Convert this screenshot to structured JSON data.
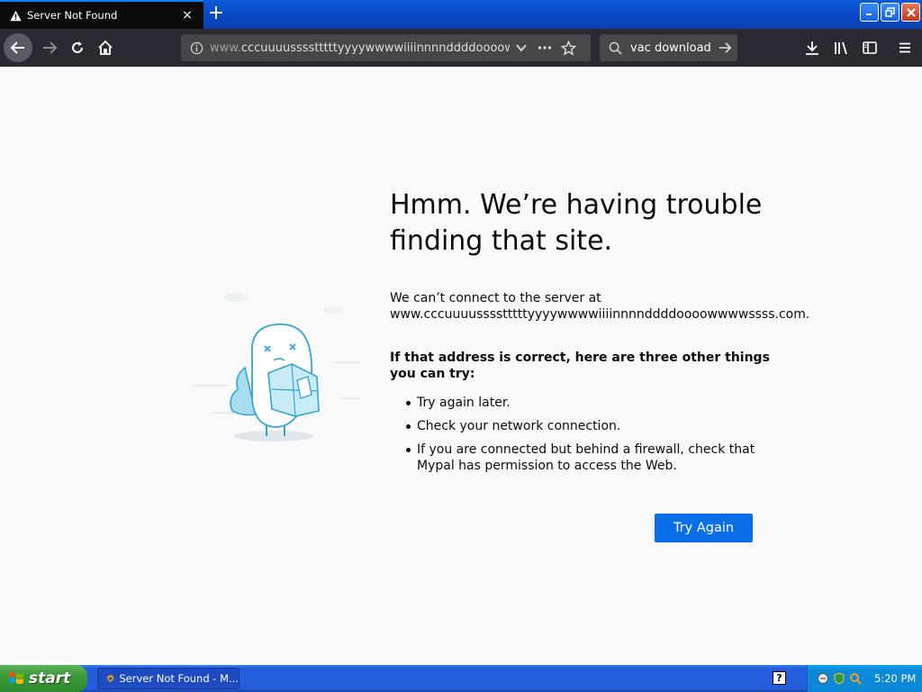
{
  "browser": {
    "tab": {
      "title": "Server Not Found",
      "close_label": "×",
      "icon": "warning-icon"
    },
    "new_tab_label": "+",
    "window_buttons": {
      "minimize": "_",
      "restore": "❐",
      "close": "✕"
    },
    "urlbar": {
      "url_prefix": "www.",
      "url_rest": "cccuuuusssstttttyyyywwwwiiiinnnnddddoooowwwwssss.com",
      "icons": [
        "info-icon",
        "chevron-down-icon",
        "more-icon",
        "star-icon"
      ]
    },
    "search": {
      "value": "vac download",
      "icon": "search-icon"
    },
    "toolbar_icons": [
      "back-icon",
      "forward-icon",
      "reload-icon",
      "home-icon",
      "download-icon",
      "library-icon",
      "sidebar-icon",
      "menu-icon"
    ]
  },
  "error_page": {
    "heading": "Hmm. We’re having trouble finding that site.",
    "desc_line1": "We can’t connect to the server at",
    "desc_address": "www.cccuuuusssstttttyyyywwwwiiiinnnnddddoooowwwwssss.com.",
    "hint": "If that address is correct, here are three other things you can try:",
    "suggestions": [
      "Try again later.",
      "Check your network connection.",
      "If you are connected but behind a firewall, check that Mypal has permission to access the Web."
    ],
    "button": "Try Again"
  },
  "taskbar": {
    "start_label": "start",
    "task_label": "Server Not Found - M...",
    "help": "?",
    "clock": "5:20 PM"
  },
  "colors": {
    "accent": "#0a84ff",
    "button": "#0a6ee8",
    "tab_bg": "#0c0c0d",
    "toolbar_bg": "#2b2a33"
  }
}
